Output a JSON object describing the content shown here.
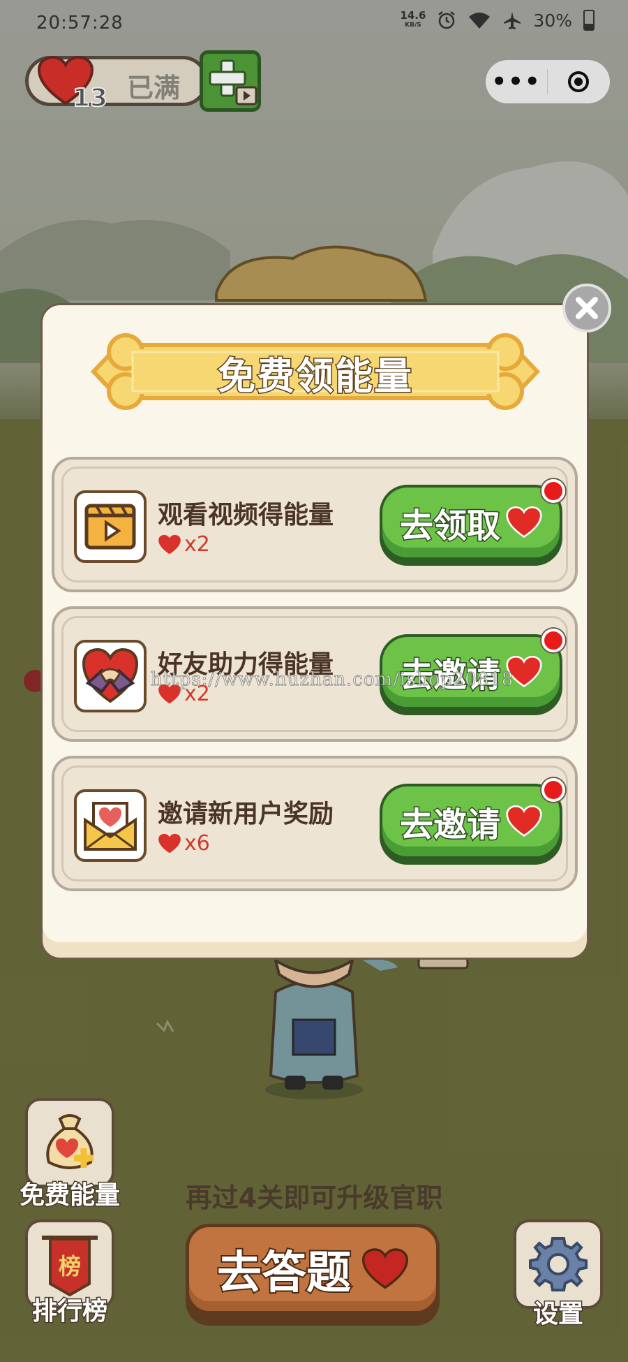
{
  "status_bar": {
    "time": "20:57:28",
    "net_speed_value": "14.6",
    "net_speed_unit": "KB/S",
    "battery": "30%"
  },
  "energy": {
    "count": "13",
    "state_label": "已满"
  },
  "capsule": {
    "menu": "•••"
  },
  "modal": {
    "title": "免费领能量",
    "items": [
      {
        "title": "观看视频得能量",
        "reward": "x2",
        "button": "去领取",
        "icon": "video-icon"
      },
      {
        "title": "好友助力得能量",
        "reward": "x2",
        "button": "去邀请",
        "icon": "handshake-heart-icon"
      },
      {
        "title": "邀请新用户奖励",
        "reward": "x6",
        "button": "去邀请",
        "icon": "envelope-heart-icon"
      }
    ]
  },
  "watermark": "https://www.huzhan.com/ishop20818",
  "bottom": {
    "free_energy_label": "免费能量",
    "rank_label": "排行榜",
    "settings_label": "设置",
    "level_hint": "再过4关即可升级官职",
    "answer_button": "去答题",
    "rank_banner_char": "榜"
  },
  "colors": {
    "primary_green": "#6cc347",
    "heart_red": "#d9322b",
    "answer_brown": "#c1743f",
    "modal_bg": "#fbf6ea",
    "banner_yellow": "#f6d772"
  }
}
